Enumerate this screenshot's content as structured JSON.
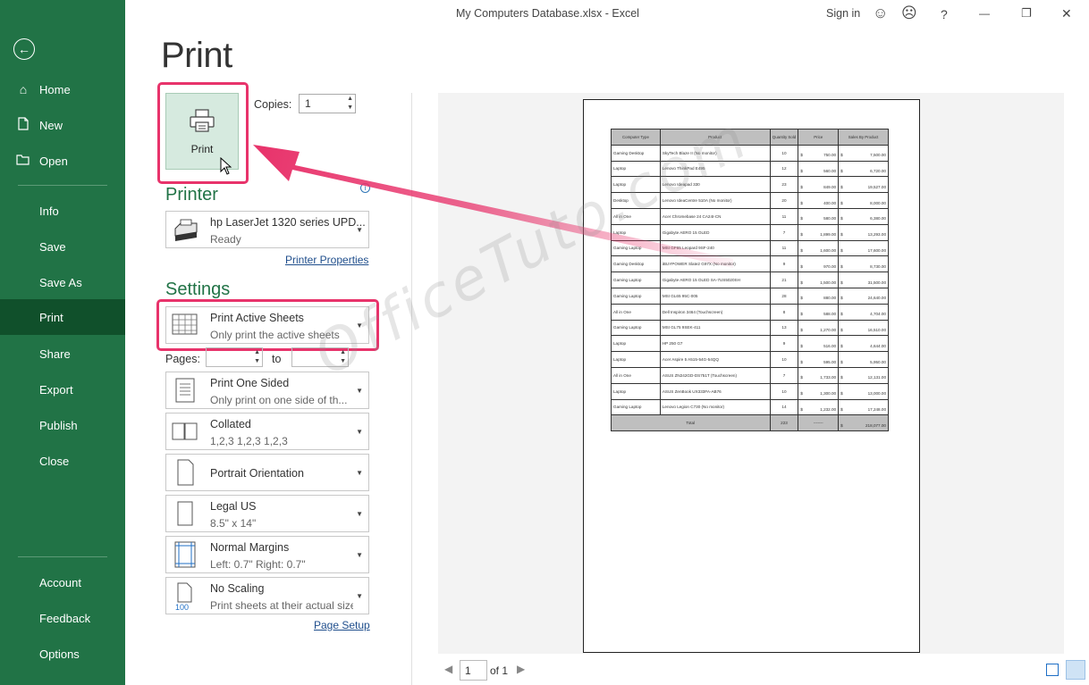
{
  "window": {
    "title": "My Computers Database.xlsx  -  Excel",
    "sign_in": "Sign in",
    "smile_icon": "☺",
    "frown_icon": "☹",
    "help_icon": "?",
    "minimize_icon": "—",
    "restore_icon": "❐",
    "close_icon": "✕"
  },
  "nav": {
    "back_icon": "←",
    "items": [
      {
        "label": "Home",
        "icon": "⌂"
      },
      {
        "label": "New",
        "icon": "🗋"
      },
      {
        "label": "Open",
        "icon": "🗁"
      },
      {
        "label": "Info"
      },
      {
        "label": "Save"
      },
      {
        "label": "Save As"
      },
      {
        "label": "Print"
      },
      {
        "label": "Share"
      },
      {
        "label": "Export"
      },
      {
        "label": "Publish"
      },
      {
        "label": "Close"
      },
      {
        "label": "Account"
      },
      {
        "label": "Feedback"
      },
      {
        "label": "Options"
      }
    ],
    "active": "Print"
  },
  "print": {
    "page_title": "Print",
    "button_label": "Print",
    "copies_label": "Copies:",
    "copies_value": "1",
    "printer_heading": "Printer",
    "printer_name": "hp LaserJet 1320 series UPD...",
    "printer_status": "Ready",
    "printer_properties_link": "Printer Properties",
    "settings_heading": "Settings",
    "pages_label": "Pages:",
    "to_label": "to",
    "page_setup_link": "Page Setup",
    "settings": [
      {
        "title": "Print Active Sheets",
        "subtitle": "Only print the active sheets"
      },
      {
        "title": "Print One Sided",
        "subtitle": "Only print on one side of th..."
      },
      {
        "title": "Collated",
        "subtitle": "1,2,3    1,2,3    1,2,3"
      },
      {
        "title": "Portrait Orientation",
        "subtitle": ""
      },
      {
        "title": "Legal US",
        "subtitle": "8.5\" x 14\""
      },
      {
        "title": "Normal Margins",
        "subtitle": "Left:  0.7\"    Right:  0.7\""
      },
      {
        "title": "No Scaling",
        "subtitle": "Print sheets at their actual size",
        "icon_text": "100"
      }
    ]
  },
  "preview": {
    "watermark": "OfficeTuto.com",
    "current_page": "1",
    "of_pages": "of 1",
    "table": {
      "headers": [
        "Computer Type",
        "Product",
        "Quantity Sold",
        "Price",
        "Sales By Product"
      ],
      "rows": [
        [
          "Gaming Desktop",
          "SkyTech Blaze II (No monitor)",
          "10",
          "750.00",
          "7,500.00"
        ],
        [
          "Laptop",
          "Lenovo ThinkPad E495",
          "12",
          "560.00",
          "6,720.00"
        ],
        [
          "Laptop",
          "Lenovo Ideapad 330",
          "23",
          "849.00",
          "19,527.00"
        ],
        [
          "Desktop",
          "Lenovo IdeaCentre 510A (No monitor)",
          "20",
          "400.00",
          "8,000.00"
        ],
        [
          "All in One",
          "Acer Chromebase 24 CA24I-CN",
          "11",
          "580.00",
          "6,380.00"
        ],
        [
          "Laptop",
          "Gigabyte AERO 15 OLED",
          "7",
          "1,899.00",
          "13,293.00"
        ],
        [
          "Gaming Laptop",
          "MSI GF65 Leopard 9SF-240",
          "11",
          "1,600.00",
          "17,600.00"
        ],
        [
          "Gaming Desktop",
          "iBUYPOWER Slate2 G97X (No monitor)",
          "9",
          "970.00",
          "8,730.00"
        ],
        [
          "Gaming Laptop",
          "Gigabyte AERO 15 OLED SA-7US5020SH",
          "21",
          "1,500.00",
          "31,500.00"
        ],
        [
          "Gaming Laptop",
          "MSI GL65 95C-005",
          "28",
          "880.00",
          "24,640.00"
        ],
        [
          "All in One",
          "Dell Inspiron 3464 (Touchscreen)",
          "8",
          "588.00",
          "4,704.00"
        ],
        [
          "Gaming Laptop",
          "MSI GL75 9SEK-411",
          "13",
          "1,270.00",
          "16,510.00"
        ],
        [
          "Laptop",
          "HP 250 G7",
          "9",
          "516.00",
          "4,644.00"
        ],
        [
          "Laptop",
          "Acer Aspire 5 A515-54G-54QQ",
          "10",
          "595.00",
          "5,950.00"
        ],
        [
          "All in One",
          "ASUS ZN242GD-DS751T (Touchscreen)",
          "7",
          "1,733.00",
          "12,131.00"
        ],
        [
          "Laptop",
          "ASUS ZenBook UX333FA-AB76",
          "10",
          "1,300.00",
          "13,000.00"
        ],
        [
          "Gaming Laptop",
          "Lenovo Legion C730 (No monitor)",
          "14",
          "1,232.00",
          "17,248.00"
        ]
      ],
      "total": {
        "label": "Total",
        "quantity": "223",
        "price": "-------",
        "sales": "218,077.00"
      },
      "currency": "$"
    }
  }
}
